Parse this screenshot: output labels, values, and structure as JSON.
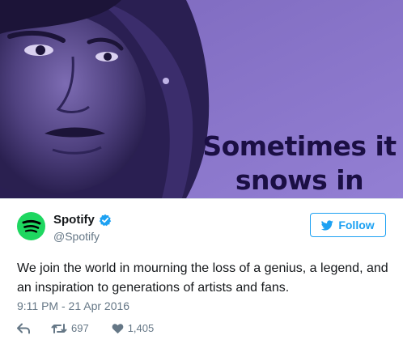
{
  "image": {
    "headline_line1": "Sometimes it",
    "headline_line2": "snows in April.",
    "tint_color": "#8a75c9",
    "headline_color": "#1b0f44"
  },
  "account": {
    "display_name": "Spotify",
    "handle": "@Spotify",
    "verified": true,
    "avatar_icon": "spotify-logo-icon",
    "avatar_color": "#1ed760"
  },
  "follow": {
    "label": "Follow",
    "icon": "bird-icon",
    "color": "#1da1f2"
  },
  "tweet": {
    "text": "We join the world in mourning the loss of a genius, a legend, and an inspiration to generations of artists and fans.",
    "timestamp": "9:11 PM - 21 Apr 2016"
  },
  "actions": {
    "reply_icon": "reply-icon",
    "retweet_icon": "retweet-icon",
    "retweet_count": "697",
    "like_icon": "heart-icon",
    "like_count": "1,405"
  }
}
